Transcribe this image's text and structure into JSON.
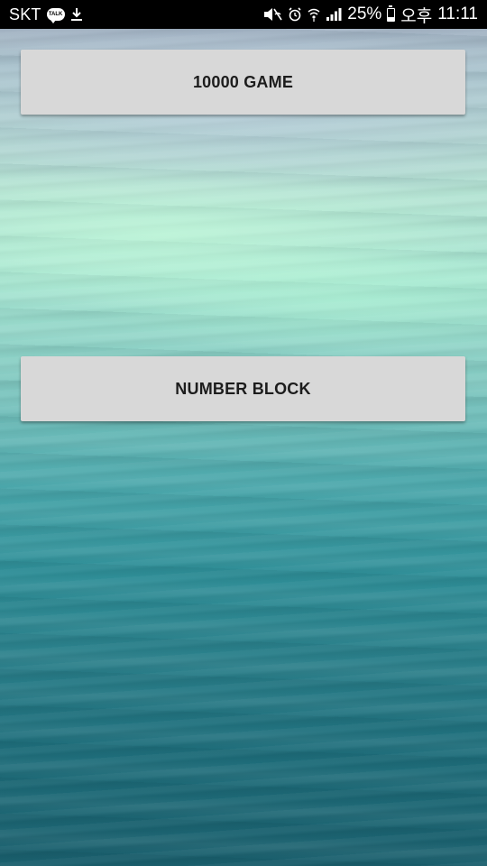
{
  "status_bar": {
    "carrier": "SKT",
    "talk_badge": "TALK",
    "battery_percent_text": "25%",
    "battery_level": 0.25,
    "ampm": "오후",
    "time": "11:11",
    "icons": [
      "kakaotalk-icon",
      "download-icon",
      "mute-icon",
      "alarm-icon",
      "wifi-icon",
      "signal-icon",
      "battery-icon"
    ]
  },
  "menu": {
    "buttons": [
      {
        "label": "10000 GAME"
      },
      {
        "label": "NUMBER BLOCK"
      }
    ]
  },
  "colors": {
    "button_bg": "#d8d8d8",
    "button_text": "#1c1c1c",
    "status_bar_bg": "#000000"
  }
}
